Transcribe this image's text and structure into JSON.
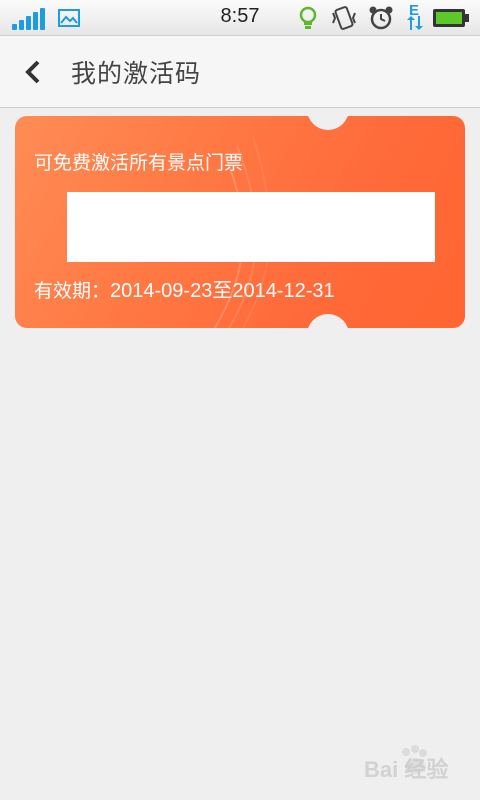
{
  "status_bar": {
    "time": "8:57",
    "data_indicator": "E",
    "icons": [
      "signal-icon",
      "gallery-icon",
      "bulb-icon",
      "vibrate-icon",
      "alarm-icon",
      "data-icon",
      "battery-icon"
    ]
  },
  "header": {
    "back_icon": "chevron-left-icon",
    "title": "我的激活码"
  },
  "ticket": {
    "description": "可免费激活所有景点门票",
    "code_value": "",
    "validity_label": "有效期：",
    "validity_value": "2014-09-23至2014-12-31",
    "colors": {
      "gradient_start": "#ff8c55",
      "gradient_end": "#ff6530"
    }
  },
  "watermark": {
    "text": "Bai 经验",
    "logo": "baidu-paw-logo"
  },
  "colors": {
    "accent": "#1f9ce0",
    "background": "#efefef"
  }
}
